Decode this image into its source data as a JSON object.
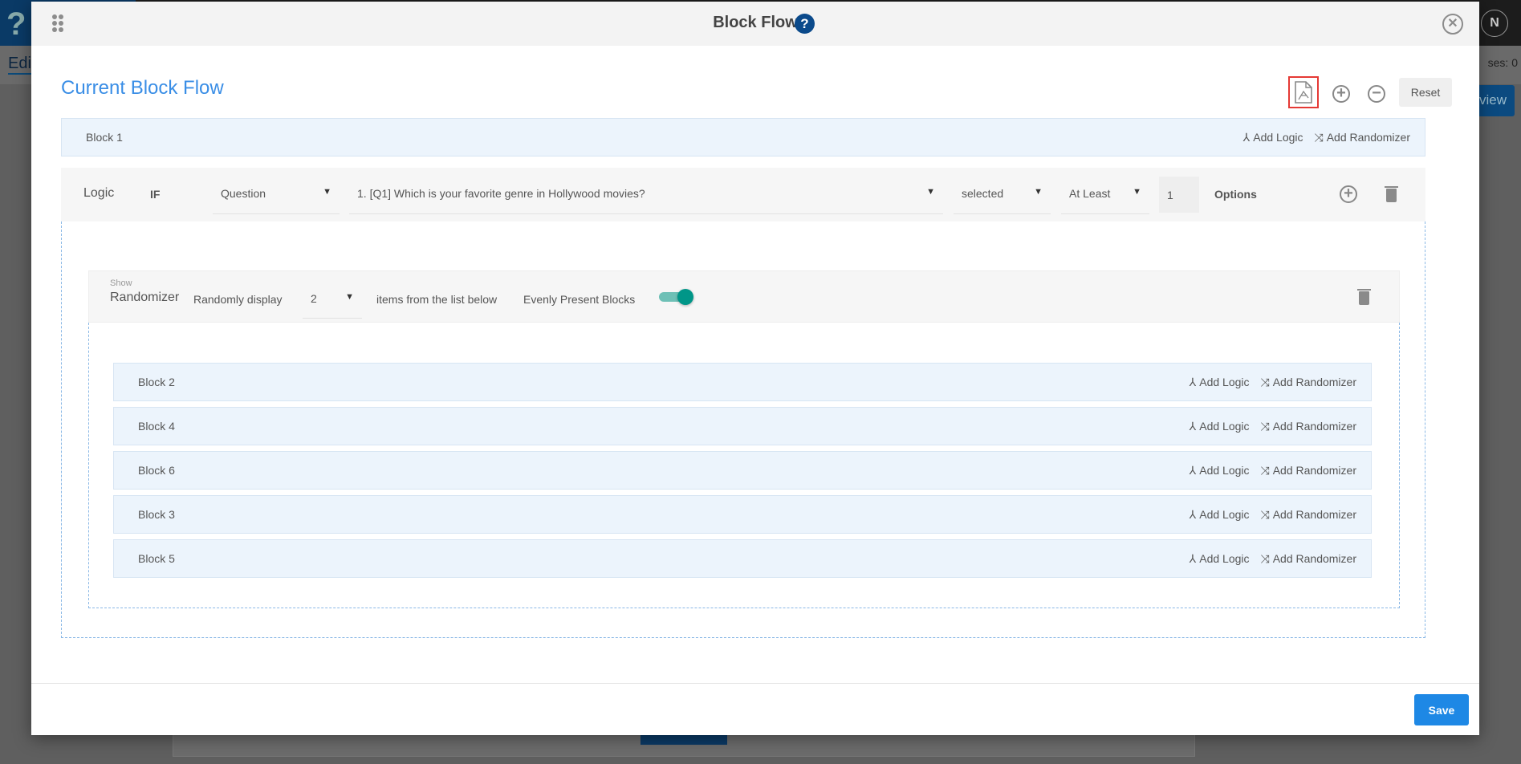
{
  "background": {
    "logo": "?",
    "edit_tab": "Edit",
    "responses": "ses: 0",
    "view_button": "view",
    "avatar_initial": "N"
  },
  "modal": {
    "title": "Block Flow",
    "help": "?",
    "heading": "Current Block Flow",
    "reset_label": "Reset",
    "save_label": "Save"
  },
  "actions": {
    "add_logic": "Add Logic",
    "add_randomizer": "Add Randomizer"
  },
  "block1": {
    "label": "Block 1"
  },
  "logic": {
    "label": "Logic",
    "if": "IF",
    "type": "Question",
    "question": "1. [Q1] Which is your favorite genre in Hollywood movies?",
    "condition": "selected",
    "quantifier": "At Least",
    "count": "1",
    "options": "Options"
  },
  "randomizer": {
    "show": "Show",
    "label": "Randomizer",
    "randomly_display": "Randomly display",
    "count": "2",
    "items_text": "items from the list below",
    "evenly": "Evenly Present Blocks",
    "evenly_on": true
  },
  "blocks": [
    {
      "label": "Block 2"
    },
    {
      "label": "Block 4"
    },
    {
      "label": "Block 6"
    },
    {
      "label": "Block 3"
    },
    {
      "label": "Block 5"
    }
  ],
  "colors": {
    "accent": "#1e88e5",
    "heading": "#3a8ee6",
    "toggle": "#009688",
    "highlight": "#e53935"
  }
}
